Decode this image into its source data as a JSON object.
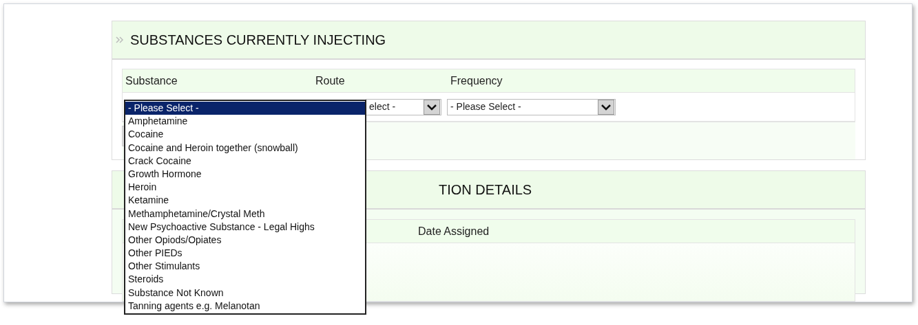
{
  "sections": [
    {
      "title": "SUBSTANCES CURRENTLY INJECTING",
      "columns": [
        "Substance",
        "Route",
        "Frequency"
      ],
      "route_select": {
        "value": "elect -"
      },
      "frequency_select": {
        "value": "- Please Select -"
      }
    },
    {
      "title": "TION DETAILS",
      "columns": [
        "Date Assigned"
      ]
    }
  ],
  "substance_dropdown": {
    "options": [
      {
        "label": "- Please Select -",
        "selected": true
      },
      {
        "label": "Amphetamine",
        "selected": false
      },
      {
        "label": "Cocaine",
        "selected": false
      },
      {
        "label": "Cocaine and Heroin together (snowball)",
        "selected": false
      },
      {
        "label": "Crack Cocaine",
        "selected": false
      },
      {
        "label": "Growth Hormone",
        "selected": false
      },
      {
        "label": "Heroin",
        "selected": false
      },
      {
        "label": "Ketamine",
        "selected": false
      },
      {
        "label": "Methamphetamine/Crystal Meth",
        "selected": false
      },
      {
        "label": "New Psychoactive Substance - Legal Highs",
        "selected": false
      },
      {
        "label": "Other Opiods/Opiates",
        "selected": false
      },
      {
        "label": "Other PIEDs",
        "selected": false
      },
      {
        "label": "Other Stimulants",
        "selected": false
      },
      {
        "label": "Steroids",
        "selected": false
      },
      {
        "label": "Substance Not Known",
        "selected": false
      },
      {
        "label": "Tanning agents e.g. Melanotan",
        "selected": false
      }
    ]
  }
}
